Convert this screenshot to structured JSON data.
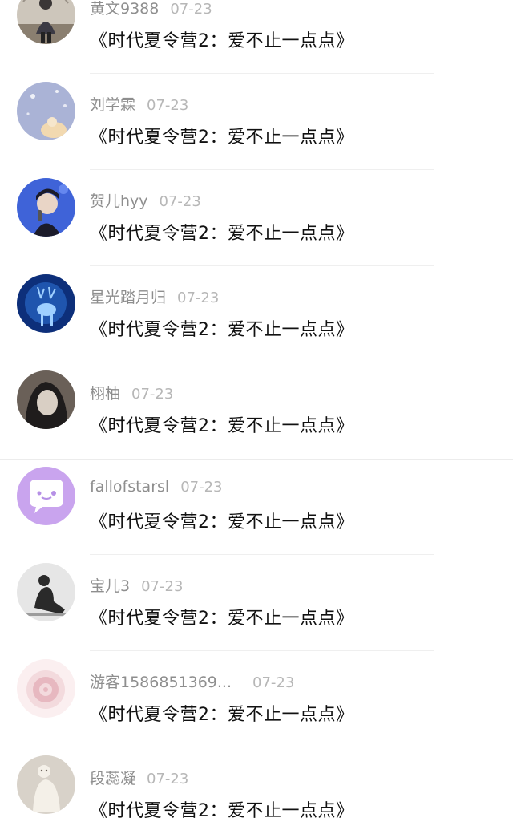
{
  "comments": [
    {
      "username": "黄文9388",
      "date": "07-23",
      "title": "《时代夏令营2：爱不止一点点》",
      "avatar_icon": "child-photo-avatar",
      "avatar_colors": [
        "#c9c2b8",
        "#3b3a44",
        "#8a7f70"
      ]
    },
    {
      "username": "刘学霖",
      "date": "07-23",
      "title": "《时代夏令营2：爱不止一点点》",
      "avatar_icon": "starry-night-avatar",
      "avatar_colors": [
        "#aab3d6",
        "#c8c6e0",
        "#f2d9b0"
      ]
    },
    {
      "username": "贺儿hyy",
      "date": "07-23",
      "title": "《时代夏令营2：爱不止一点点》",
      "avatar_icon": "singer-photo-avatar",
      "avatar_colors": [
        "#3f63d8",
        "#1b1b2a",
        "#e9d5c6"
      ]
    },
    {
      "username": "星光踏月归",
      "date": "07-23",
      "title": "《时代夏令营2：爱不止一点点》",
      "avatar_icon": "blue-deer-avatar",
      "avatar_colors": [
        "#0d2f7a",
        "#2c6fd1",
        "#9fd0ff"
      ]
    },
    {
      "username": "栩柚",
      "date": "07-23",
      "title": "《时代夏令营2：爱不止一点点》",
      "avatar_icon": "anime-character-avatar",
      "avatar_colors": [
        "#6a6058",
        "#1f1c1c",
        "#d9cfc4"
      ]
    },
    {
      "username": "fallofstarsl",
      "date": "07-23",
      "title": "《时代夏令营2：爱不止一点点》",
      "avatar_icon": "chat-bubble-avatar",
      "avatar_colors": [
        "#c9a4ee",
        "#ffffff",
        "#b690e6"
      ]
    },
    {
      "username": "宝儿3",
      "date": "07-23",
      "title": "《时代夏令营2：爱不止一点点》",
      "avatar_icon": "sitting-person-avatar",
      "avatar_colors": [
        "#e6e6e6",
        "#2a2a2a",
        "#9c9c9c"
      ]
    },
    {
      "username": "游客1586851369...",
      "date": "07-23",
      "title": "《时代夏令营2：爱不止一点点》",
      "avatar_icon": "pink-flower-avatar",
      "avatar_colors": [
        "#f3dadd",
        "#e7b8c0",
        "#fbeff0"
      ]
    },
    {
      "username": "段蕊凝",
      "date": "07-23",
      "title": "《时代夏令营2：爱不止一点点》",
      "avatar_icon": "white-figure-avatar",
      "avatar_colors": [
        "#d8d2c9",
        "#f4f0e8",
        "#6b625a"
      ]
    }
  ]
}
